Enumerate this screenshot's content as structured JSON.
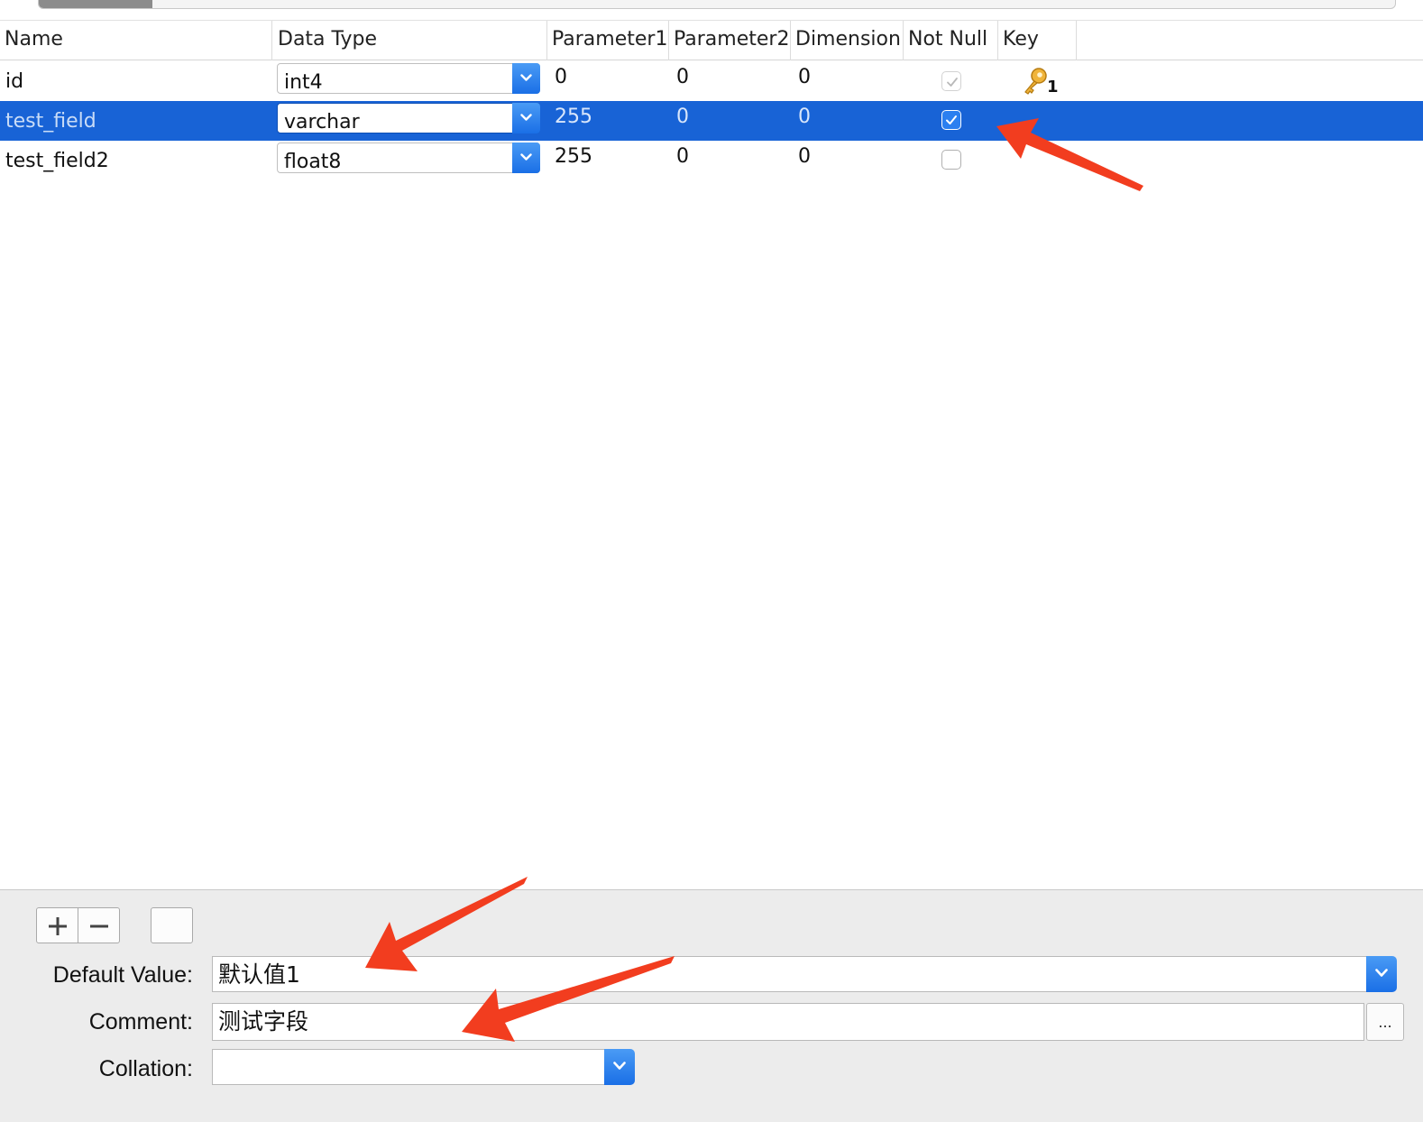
{
  "columns": [
    "Name",
    "Data Type",
    "Parameter1",
    "Parameter2",
    "Dimension",
    "Not Null",
    "Key"
  ],
  "rows": [
    {
      "name": "id",
      "data_type": "int4",
      "parameter1": "0",
      "parameter2": "0",
      "dimension": "0",
      "not_null": true,
      "key": "1"
    },
    {
      "name": "test_field",
      "data_type": "varchar",
      "parameter1": "255",
      "parameter2": "0",
      "dimension": "0",
      "not_null": true,
      "key": ""
    },
    {
      "name": "test_field2",
      "data_type": "float8",
      "parameter1": "255",
      "parameter2": "0",
      "dimension": "0",
      "not_null": false,
      "key": ""
    }
  ],
  "selected_row": 1,
  "form": {
    "default_value_label": "Default Value:",
    "default_value": "默认值1",
    "comment_label": "Comment:",
    "comment": "测试字段",
    "collation_label": "Collation:",
    "collation": "",
    "more_button": "..."
  },
  "colors": {
    "selection": "#1863d6",
    "accent": "#1a6fe6",
    "annotation": "#f23d1f",
    "key_icon": "#e8a92c"
  }
}
